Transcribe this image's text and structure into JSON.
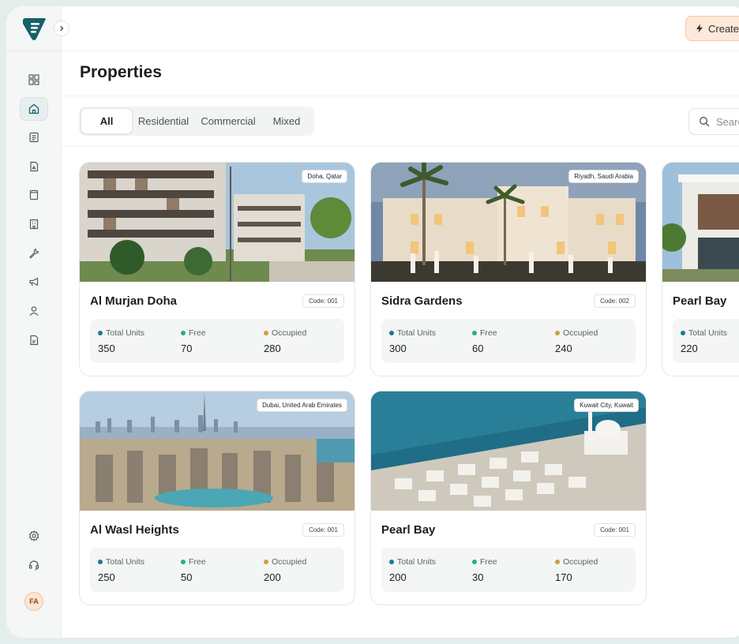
{
  "sidebar": {
    "avatar_initials": "FA",
    "nav_items": [
      {
        "name": "dashboard-grid-icon",
        "active": false
      },
      {
        "name": "home-icon",
        "active": true
      },
      {
        "name": "document-list-icon",
        "active": false
      },
      {
        "name": "file-icon",
        "active": false
      },
      {
        "name": "archive-icon",
        "active": false
      },
      {
        "name": "building-icon",
        "active": false
      },
      {
        "name": "wrench-icon",
        "active": false
      },
      {
        "name": "megaphone-icon",
        "active": false
      },
      {
        "name": "user-icon",
        "active": false
      },
      {
        "name": "report-icon",
        "active": false
      }
    ],
    "bottom_items": [
      {
        "name": "settings-gear-icon"
      },
      {
        "name": "headset-support-icon"
      }
    ]
  },
  "header": {
    "create_label": "Create"
  },
  "page": {
    "title": "Properties"
  },
  "filters": {
    "tabs": [
      {
        "label": "All",
        "active": true
      },
      {
        "label": "Residential",
        "active": false
      },
      {
        "label": "Commercial",
        "active": false
      },
      {
        "label": "Mixed",
        "active": false
      }
    ],
    "search_placeholder": "Search"
  },
  "stat_labels": {
    "total": "Total Units",
    "free": "Free",
    "occupied": "Occupied"
  },
  "colors": {
    "brand": "#14626a",
    "total_dot": "#1b7c8a",
    "free_dot": "#22b573",
    "occupied_dot": "#c9a23a",
    "create_button": "#fde9da"
  },
  "properties": [
    {
      "name": "Al Murjan Doha",
      "location": "Doha, Qatar",
      "code": "Code: 001",
      "total_units": "350",
      "free": "70",
      "occupied": "280"
    },
    {
      "name": "Sidra Gardens",
      "location": "Riyadh, Saudi Arabia",
      "code": "Code: 002",
      "total_units": "300",
      "free": "60",
      "occupied": "240"
    },
    {
      "name": "Pearl Bay",
      "location": "",
      "code": "",
      "total_units": "220",
      "free": "",
      "occupied": ""
    },
    {
      "name": "Al Wasl Heights",
      "location": "Dubai, United Arab Emirates",
      "code": "Code: 001",
      "total_units": "250",
      "free": "50",
      "occupied": "200"
    },
    {
      "name": "Pearl Bay",
      "location": "Kuwait City, Kuwait",
      "code": "Code: 001",
      "total_units": "200",
      "free": "30",
      "occupied": "170"
    }
  ]
}
